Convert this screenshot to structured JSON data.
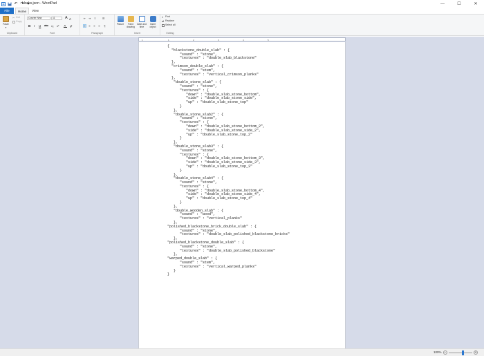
{
  "window": {
    "title": "blocks.json - WordPad",
    "minimize": "—",
    "maximize": "☐",
    "close": "✕"
  },
  "quick_access": [
    "save-icon",
    "undo-icon",
    "redo-icon",
    "customize-icon"
  ],
  "tabs": {
    "file": "File",
    "home": "Home",
    "view": "View"
  },
  "ribbon": {
    "clipboard": {
      "label": "Clipboard",
      "paste": "Paste",
      "cut": "Cut",
      "copy": "Copy"
    },
    "font": {
      "label": "Font",
      "family": "Courier New",
      "size": "11",
      "grow": "A",
      "shrink": "A",
      "bold": "B",
      "italic": "I",
      "underline": "U",
      "strike": "abc",
      "sub": "x₂",
      "sup": "x²"
    },
    "paragraph": {
      "label": "Paragraph"
    },
    "insert": {
      "label": "Insert",
      "picture": "Picture",
      "paint": "Paint drawing",
      "datetime": "Date and time",
      "object": "Insert object"
    },
    "editing": {
      "label": "Editing",
      "find": "Find",
      "replace": "Replace",
      "select_all": "Select all"
    }
  },
  "ruler": {
    "ticks": [
      "1",
      "1",
      "2",
      "3",
      "4",
      "5"
    ]
  },
  "document": {
    "lines": [
      "{",
      "  \"blackstone_double_slab\" : {",
      "      \"sound\" : \"stone\",",
      "      \"textures\" : \"double_slab_blackstone\"",
      "  },",
      "  \"crimson_double_slab\" : {",
      "      \"sound\" : \"stem\",",
      "      \"textures\" : \"vertical_crimson_planks\"",
      "  },",
      "   \"double_stone_slab\" : {",
      "      \"sound\" : \"stone\",",
      "      \"textures\" : {",
      "         \"down\" : \"double_slab_stone_bottom\",",
      "         \"side\" : \"double_slab_stone_side\",",
      "         \"up\" : \"double_slab_stone_top\"",
      "      }",
      "   },",
      "   \"double_stone_slab2\" : {",
      "      \"sound\" : \"stone\",",
      "      \"textures\" : {",
      "         \"down\" : \"double_slab_stone_bottom_2\",",
      "         \"side\" : \"double_slab_stone_side_2\",",
      "         \"up\" : \"double_slab_stone_top_2\"",
      "      }",
      "   },",
      "   \"double_stone_slab3\" : {",
      "      \"sound\" : \"stone\",",
      "      \"textures\" : {",
      "         \"down\" : \"double_slab_stone_bottom_3\",",
      "         \"side\" : \"double_slab_stone_side_3\",",
      "         \"up\" : \"double_slab_stone_top_3\"",
      "      }",
      "   },",
      "   \"double_stone_slab4\" : {",
      "      \"sound\" : \"stone\",",
      "      \"textures\" : {",
      "         \"down\" : \"double_slab_stone_bottom_4\",",
      "         \"side\" : \"double_slab_stone_side_4\",",
      "         \"up\" : \"double_slab_stone_top_4\"",
      "      }",
      "   },",
      "   \"double_wooden_slab\" : {",
      "      \"sound\" : \"wood\",",
      "      \"textures\" : \"vertical_planks\"",
      "   },",
      "\"polished_blackstone_brick_double_slab\" : {",
      "      \"sound\" : \"stone\",",
      "      \"textures\" : \"double_slab_polished_blackstone_bricks\"",
      "   },",
      "\"polished_blackstone_double_slab\" : {",
      "      \"sound\" : \"stone\",",
      "      \"textures\" : \"double_slab_polished_blackstone\"",
      "   },",
      "\"warped_double_slab\" : {",
      "      \"sound\" : \"stem\",",
      "      \"textures\" : \"vertical_warped_planks\"",
      "   }",
      "}"
    ]
  },
  "status": {
    "zoom": "100%",
    "zoom_out": "−",
    "zoom_in": "+",
    "zoom_level": 0.6
  }
}
